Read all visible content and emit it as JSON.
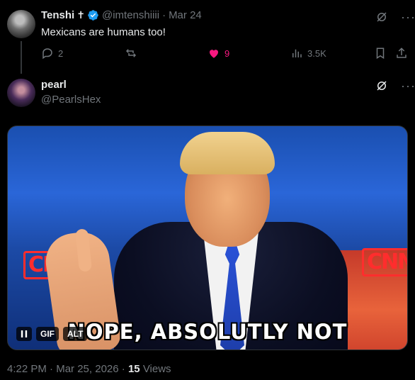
{
  "reply_parent": {
    "display_name": "Tenshi",
    "name_suffix": "✝",
    "handle": "@imtenshiiii",
    "separator": "·",
    "date": "Mar 24",
    "text": "Mexicans are humans too!",
    "actions": {
      "replies": "2",
      "reposts": "",
      "likes": "9",
      "views": "3.5K"
    },
    "like_color": "#f91880"
  },
  "main_post": {
    "display_name": "pearl",
    "handle": "@PearlsHex",
    "gif": {
      "caption": "NOPE, ABSOLUTLY NOT",
      "badge_gif": "GIF",
      "badge_alt": "ALT",
      "logo_text": "CNN"
    },
    "timestamp": "4:22 PM",
    "date": "Mar 25, 2026",
    "views_count": "15",
    "views_label": "Views"
  },
  "colors": {
    "background": "#000000",
    "text_primary": "#e7e9ea",
    "text_muted": "#71767b",
    "verified_blue": "#1d9bf0"
  },
  "icons": [
    "reply-icon",
    "repost-icon",
    "heart-icon",
    "views-icon",
    "bookmark-icon",
    "share-icon",
    "grok-icon",
    "more-icon",
    "verified-icon",
    "pause-icon"
  ]
}
